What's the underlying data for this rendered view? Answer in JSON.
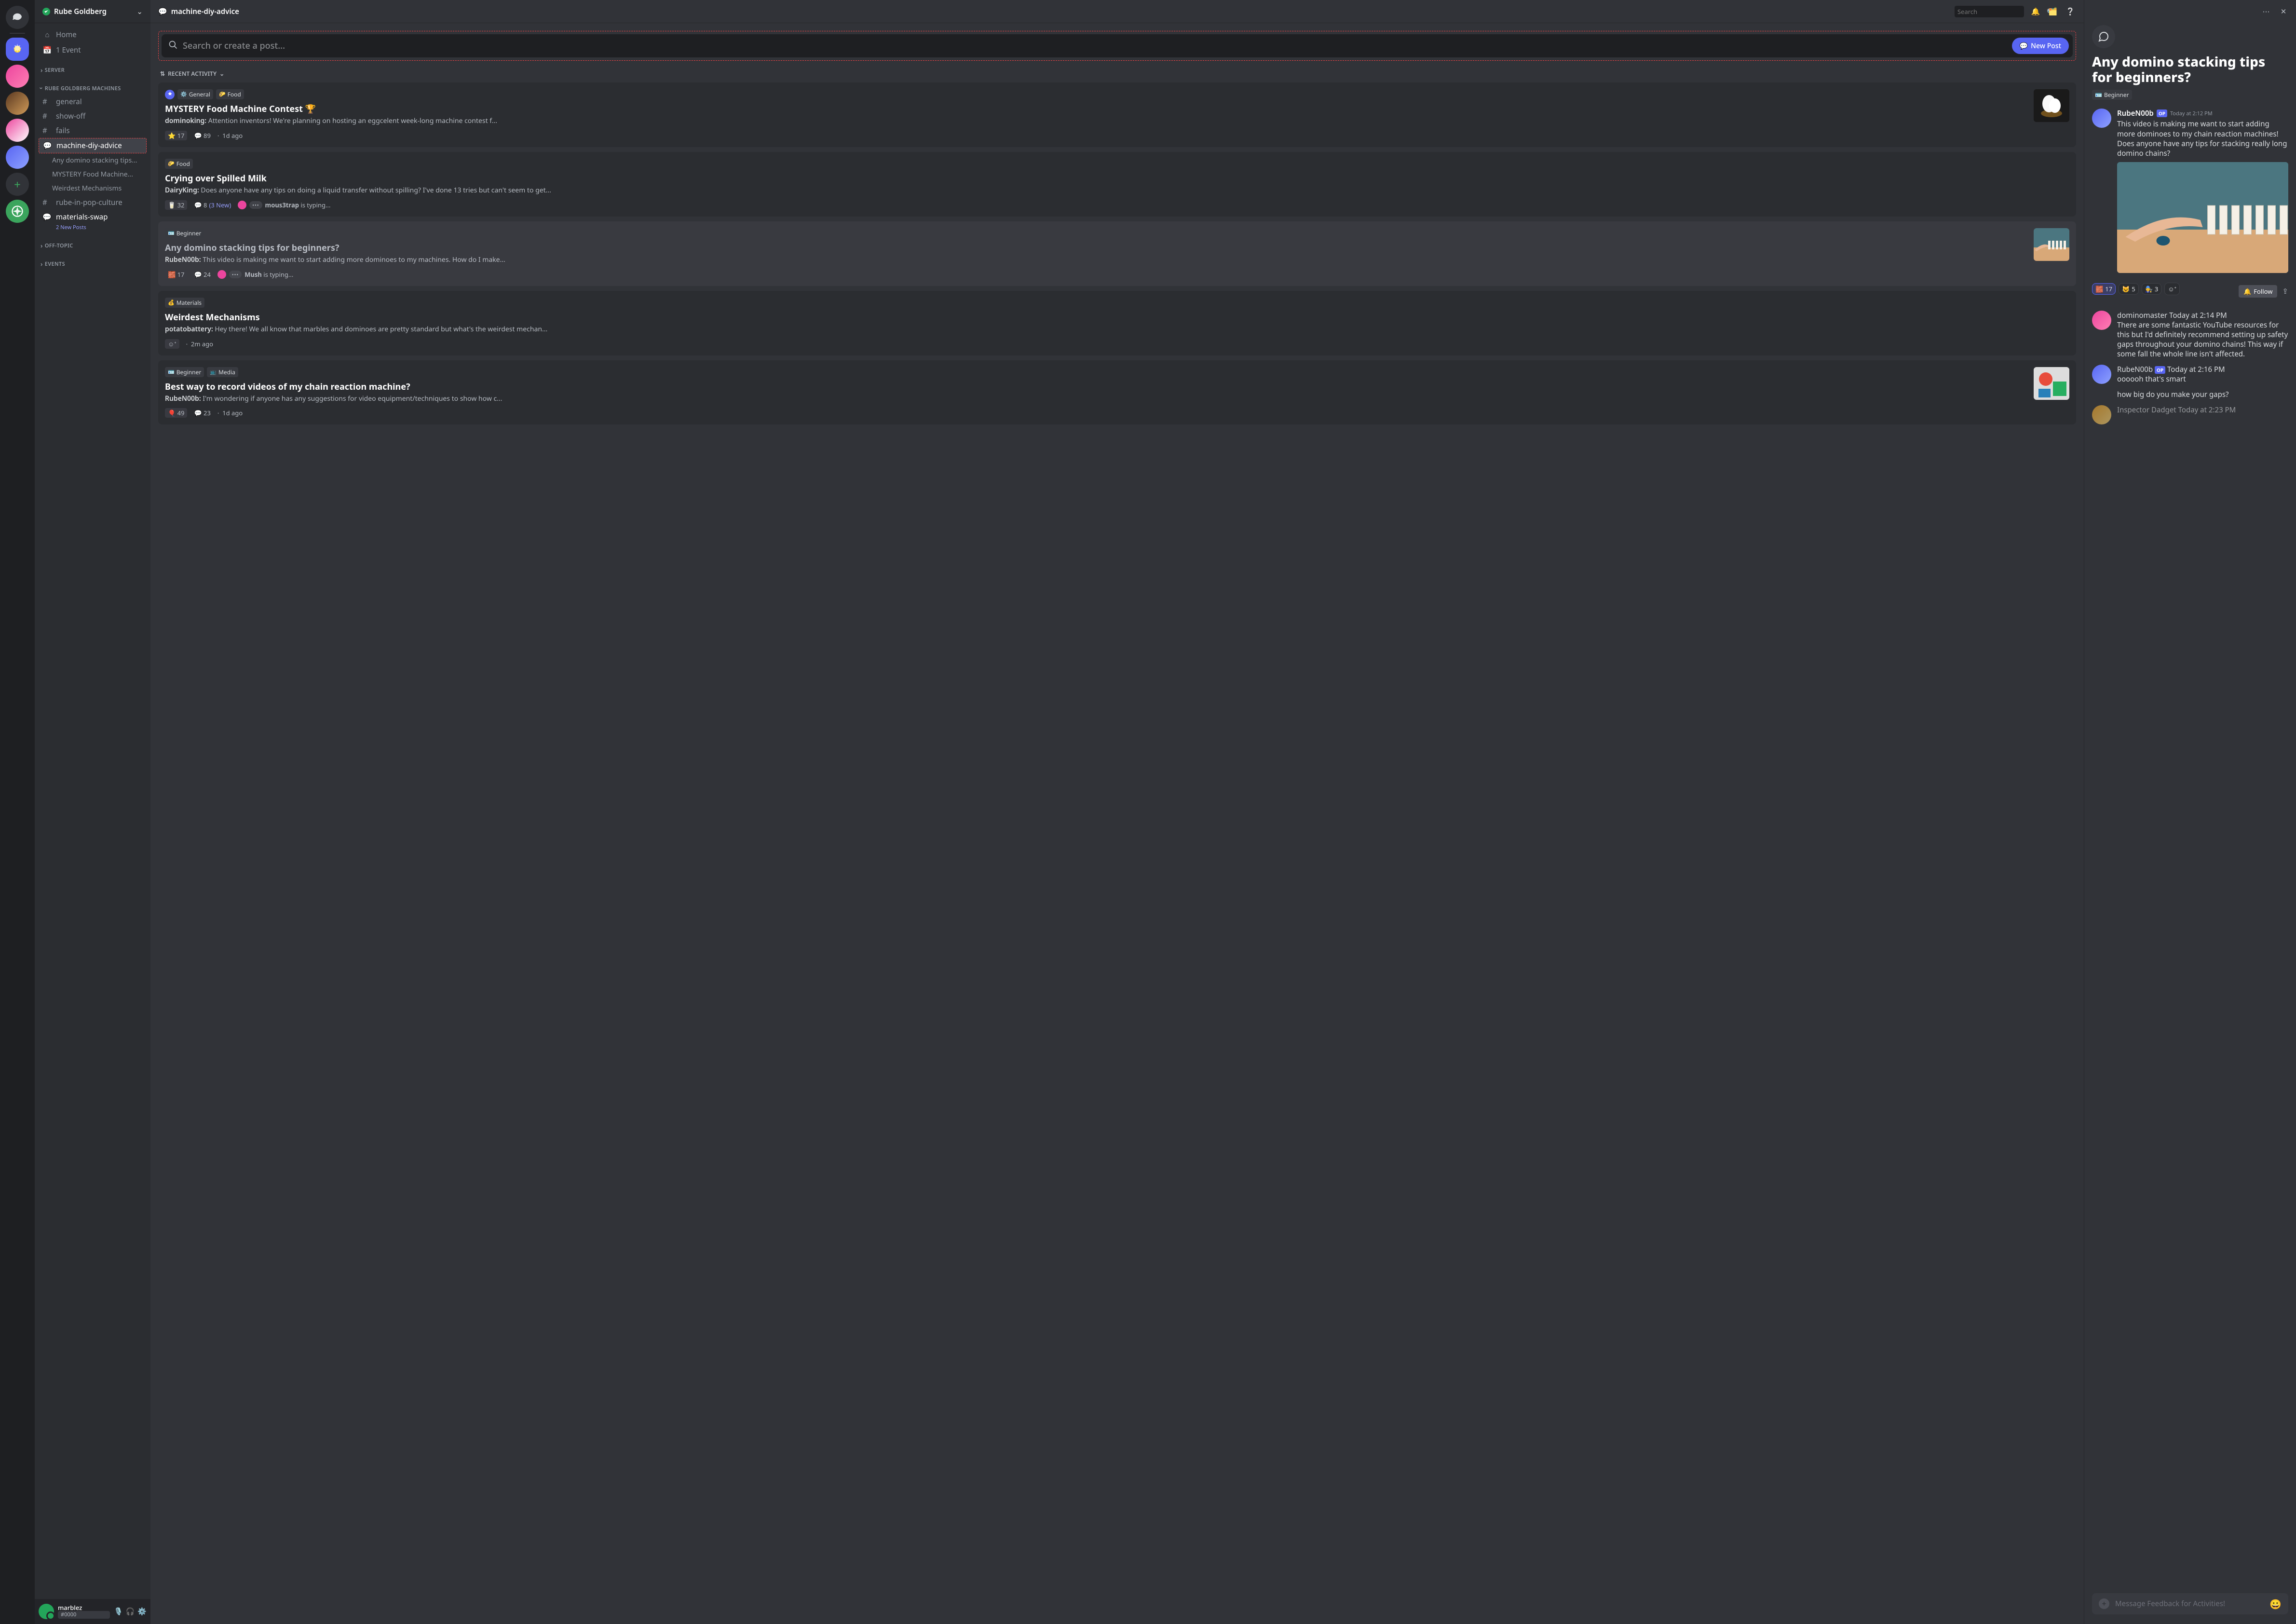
{
  "server": {
    "name": "Rube Goldberg",
    "home": "Home",
    "event": "1 Event",
    "sections": {
      "server": "SERVER",
      "machines": "RUBE GOLDBERG MACHINES",
      "offtopic": "OFF-TOPIC",
      "events": "EVENTS"
    },
    "channels": {
      "general": "general",
      "showoff": "show-off",
      "fails": "fails",
      "advice": "machine-diy-advice",
      "pop": "rube-in-pop-culture",
      "materials": "materials-swap",
      "materials_sub": "2 New Posts"
    },
    "threads": {
      "0": "Any domino stacking tips...",
      "1": "MYSTERY Food Machine...",
      "2": "Weirdest Mechanisms"
    }
  },
  "user": {
    "name": "marblez",
    "tag": "#0000"
  },
  "topbar": {
    "channel": "machine-diy-advice",
    "search_placeholder": "Search"
  },
  "forum": {
    "search_placeholder": "Search or create a post...",
    "new_post": "New Post",
    "sort": "RECENT ACTIVITY"
  },
  "posts": [
    {
      "pinned": true,
      "tags": [
        {
          "emoji": "⚙️",
          "label": "General",
          "name": "tag-general"
        },
        {
          "emoji": "🌮",
          "label": "Food",
          "name": "tag-food"
        }
      ],
      "title": "MYSTERY Food Machine Contest 🏆",
      "author": "dominoking:",
      "excerpt": "Attention inventors! We're planning on hosting an eggcelent week-long machine contest f...",
      "react": {
        "emoji": "⭐",
        "count": "17"
      },
      "messages": "89",
      "age": "1d ago",
      "thumb": true
    },
    {
      "tags": [
        {
          "emoji": "🌮",
          "label": "Food",
          "name": "tag-food"
        }
      ],
      "title": "Crying over Spilled Milk",
      "author": "DairyKing:",
      "excerpt": "Does anyone have any tips on doing a liquid transfer without spilling? I've done 13 tries but can't seem to get...",
      "react": {
        "emoji": "🥛",
        "count": "32"
      },
      "messages": "8",
      "new": "(3 New)",
      "typing": {
        "user": "mous3trap",
        "suffix": " is typing..."
      }
    },
    {
      "selected": true,
      "tags": [
        {
          "emoji": "🪪",
          "label": "Beginner",
          "name": "tag-beginner"
        }
      ],
      "title": "Any domino stacking tips for beginners?",
      "author": "RubeN00b:",
      "excerpt": "This video is making me want to start adding more dominoes to my machines. How do I make...",
      "react": {
        "emoji": "🧱",
        "count": "17"
      },
      "messages": "24",
      "typing": {
        "user": "Mush",
        "suffix": " is typing..."
      },
      "thumb": true
    },
    {
      "tags": [
        {
          "emoji": "💰",
          "label": "Materials",
          "name": "tag-materials"
        }
      ],
      "title": "Weirdest Mechanisms",
      "author": "potatobattery:",
      "excerpt": "Hey there! We all know that marbles and dominoes are pretty standard but what's the weirdest mechan...",
      "add_react": true,
      "age": "2m ago"
    },
    {
      "tags": [
        {
          "emoji": "🪪",
          "label": "Beginner",
          "name": "tag-beginner"
        },
        {
          "emoji": "📺",
          "label": "Media",
          "name": "tag-media"
        }
      ],
      "title": "Best way to record videos of my chain reaction machine?",
      "author": "RubeN00b:",
      "excerpt": "I'm wondering if anyone has any suggestions for video equipment/techniques to show how c...",
      "react": {
        "emoji": "🎈",
        "count": "49"
      },
      "messages": "23",
      "age": "1d ago",
      "thumb": true
    }
  ],
  "thread": {
    "title": "Any domino stacking tips for beginners?",
    "tag": {
      "emoji": "🪪",
      "label": "Beginner"
    },
    "op": {
      "author": "RubeN00b",
      "badge": "OP",
      "ts": "Today at 2:12 PM",
      "content": "This video is making me want to start adding more dominoes to my chain reaction machines! Does anyone have any tips for stacking really long domino chains?"
    },
    "reactions": [
      {
        "emoji": "🧱",
        "count": "17",
        "active": true
      },
      {
        "emoji": "😺",
        "count": "5"
      },
      {
        "emoji": "🧑‍🔧",
        "count": "3"
      }
    ],
    "follow": "Follow",
    "replies": [
      {
        "author": "dominomaster",
        "ts": "Today at 2:14 PM",
        "content": "There are some fantastic YouTube resources for this but I'd definitely recommend setting up safety gaps throughout your domino chains! This way if some fall the whole line isn't affected."
      },
      {
        "author": "RubeN00b",
        "badge": "OP",
        "ts": "Today at 2:16 PM",
        "content": "oooooh that's smart",
        "content2": "how big do you make your gaps?"
      },
      {
        "author": "Inspector Dadget",
        "ts": "Today at 2:23 PM"
      }
    ],
    "composer_placeholder": "Message Feedback for Activities!"
  }
}
